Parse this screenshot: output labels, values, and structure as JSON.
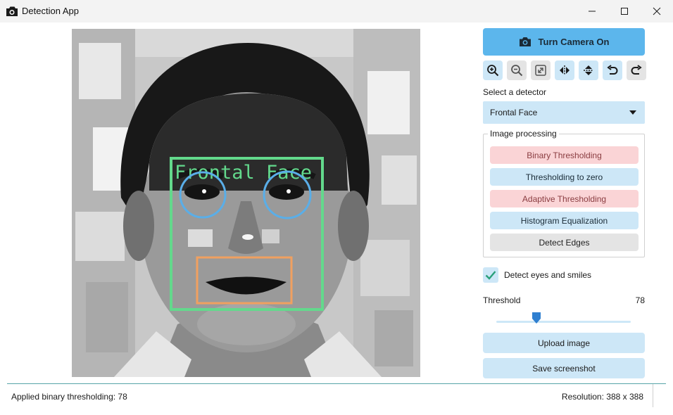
{
  "window": {
    "title": "Detection App",
    "icon": "camera-icon"
  },
  "image": {
    "overlay_label": "Frontal Face",
    "colors": {
      "face_box": "#63d98c",
      "eye_circle": "#5aaee8",
      "mouth_box": "#f0a060"
    }
  },
  "controls": {
    "camera_button": "Turn Camera On",
    "toolbar": [
      "zoom-in-icon",
      "zoom-out-icon",
      "fit-screen-icon",
      "flip-horizontal-icon",
      "flip-vertical-icon",
      "undo-icon",
      "redo-icon"
    ],
    "detector_label": "Select a detector",
    "detector_value": "Frontal Face",
    "processing_title": "Image processing",
    "processing_buttons": [
      "Binary Thresholding",
      "Thresholding to zero",
      "Adaptive Thresholding",
      "Histogram Equalization",
      "Detect Edges"
    ],
    "detect_checkbox_label": "Detect eyes and smiles",
    "detect_checkbox_checked": true,
    "threshold_label": "Threshold",
    "threshold_value": "78",
    "threshold_fraction": 0.3,
    "upload_button": "Upload image",
    "screenshot_button": "Save screenshot"
  },
  "status": {
    "message": "Applied binary thresholding: 78",
    "resolution": "Resolution: 388 x 388"
  },
  "colors": {
    "accent": "#5cb6ec",
    "light_blue": "#cde7f7",
    "pink": "#fad4d6",
    "check": "#2aa07a"
  }
}
